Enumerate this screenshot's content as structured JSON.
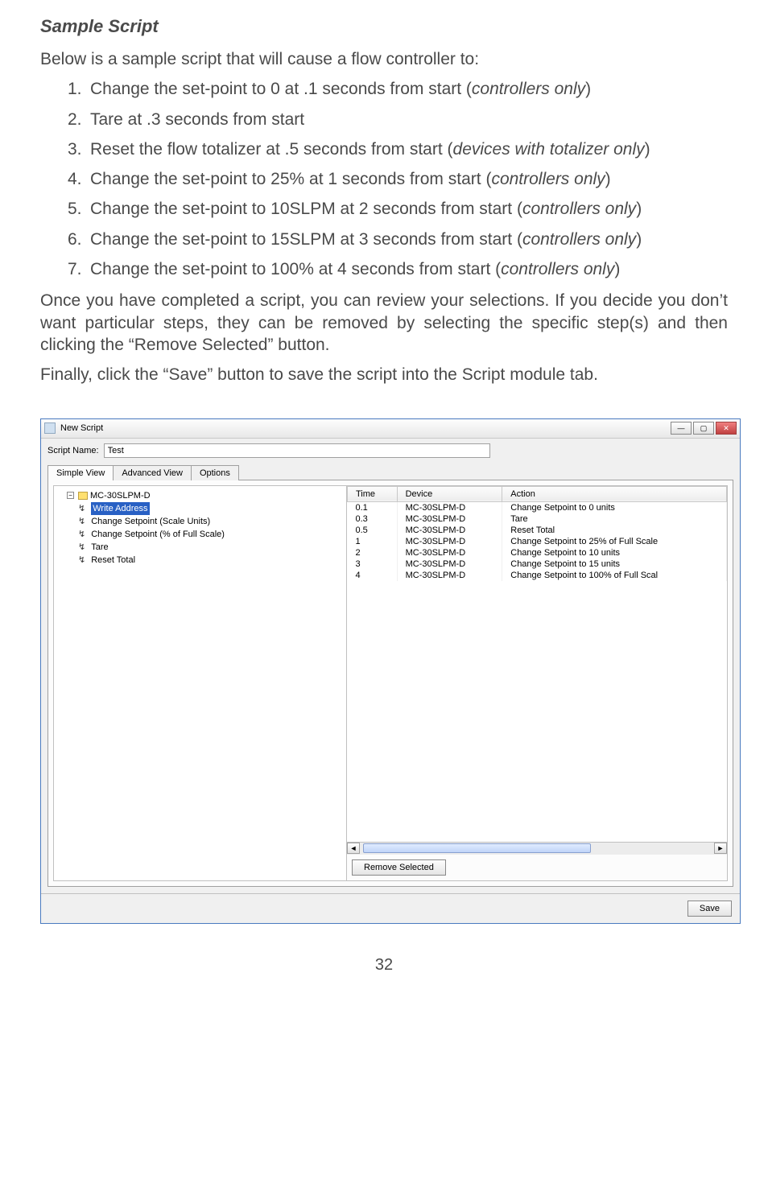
{
  "title": "Sample Script",
  "intro": "Below is a sample script that will cause a flow controller to:",
  "steps": [
    {
      "n": "1.",
      "text_a": "Change the set-point to 0 at .1 seconds from start (",
      "em": "controllers only",
      "text_b": ")"
    },
    {
      "n": "2.",
      "text_a": "Tare at .3 seconds from start",
      "em": "",
      "text_b": ""
    },
    {
      "n": "3.",
      "text_a": "Reset the flow totalizer at .5 seconds from start (",
      "em": "devices with totalizer only",
      "text_b": ")"
    },
    {
      "n": "4.",
      "text_a": "Change the set-point to 25% at 1 seconds from start (",
      "em": "controllers only",
      "text_b": ")"
    },
    {
      "n": "5.",
      "text_a": "Change the set-point to 10SLPM at 2 seconds from start (",
      "em": "controllers only",
      "text_b": ")"
    },
    {
      "n": "6.",
      "text_a": "Change the set-point to 15SLPM at 3 seconds from start (",
      "em": "controllers only",
      "text_b": ")"
    },
    {
      "n": "7.",
      "text_a": "Change the set-point to 100% at 4 seconds from start (",
      "em": "controllers only",
      "text_b": ")"
    }
  ],
  "para2": "Once you have completed a script, you can review your selections. If you decide you don’t want particular steps, they can be removed by selecting the specific step(s) and then clicking the “Remove Selected” button.",
  "para3": "Finally, click the “Save” button to save the script into the Script module tab.",
  "window": {
    "title": "New Script",
    "script_label": "Script Name:",
    "script_value": "Test",
    "tabs": [
      "Simple View",
      "Advanced View",
      "Options"
    ],
    "tree": {
      "root": "MC-30SLPM-D",
      "items": [
        "Write Address",
        "Change Setpoint (Scale Units)",
        "Change Setpoint (% of Full Scale)",
        "Tare",
        "Reset Total"
      ]
    },
    "columns": [
      "Time",
      "Device",
      "Action"
    ],
    "rows": [
      {
        "time": "0.1",
        "device": "MC-30SLPM-D",
        "action": "Change Setpoint to 0 units"
      },
      {
        "time": "0.3",
        "device": "MC-30SLPM-D",
        "action": "Tare"
      },
      {
        "time": "0.5",
        "device": "MC-30SLPM-D",
        "action": "Reset Total"
      },
      {
        "time": "1",
        "device": "MC-30SLPM-D",
        "action": "Change Setpoint to 25% of Full Scale"
      },
      {
        "time": "2",
        "device": "MC-30SLPM-D",
        "action": "Change Setpoint to 10 units"
      },
      {
        "time": "3",
        "device": "MC-30SLPM-D",
        "action": "Change Setpoint to 15 units"
      },
      {
        "time": "4",
        "device": "MC-30SLPM-D",
        "action": "Change Setpoint to 100% of Full Scal"
      }
    ],
    "remove_btn": "Remove Selected",
    "save_btn": "Save"
  },
  "page_number": "32"
}
